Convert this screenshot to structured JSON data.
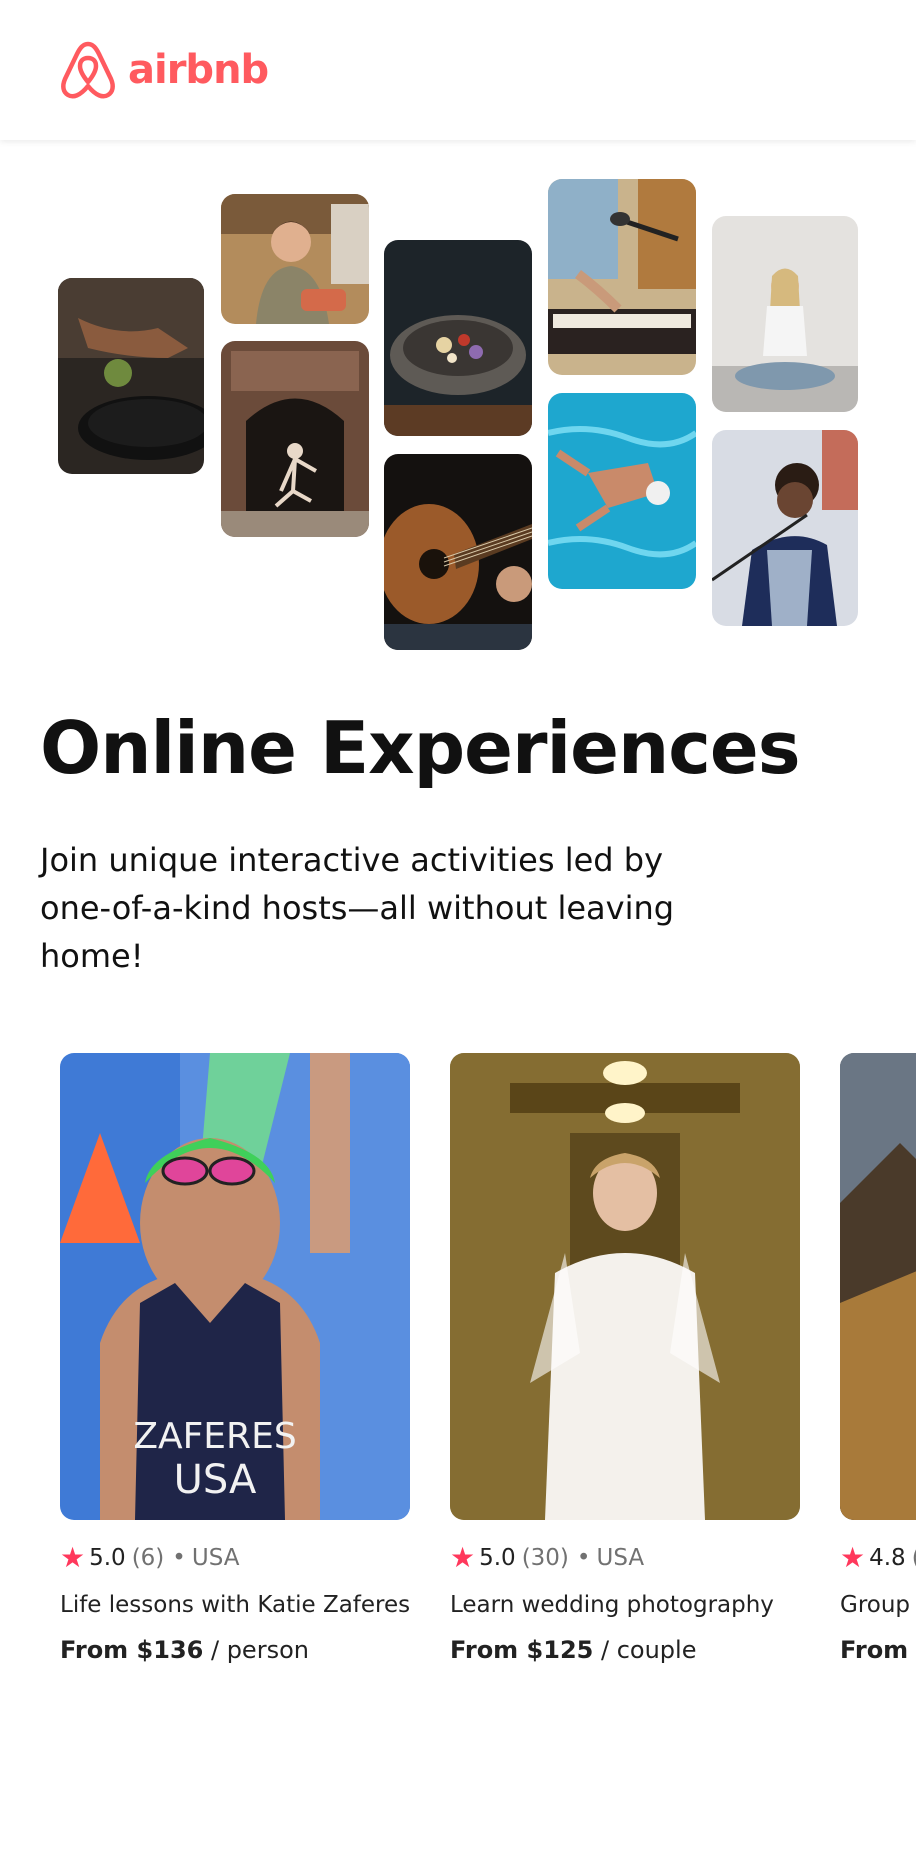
{
  "brand": {
    "name": "airbnb",
    "color": "#FF5A5F"
  },
  "hero": {
    "title": "Online Experiences",
    "subtitle": "Join unique interactive activities led by one-of-a-kind hosts—all without leaving home!"
  },
  "collage": [
    {
      "name": "cooking-pan-photo"
    },
    {
      "name": "chef-woman-photo"
    },
    {
      "name": "dancer-archway-photo"
    },
    {
      "name": "food-bowl-photo"
    },
    {
      "name": "guitar-photo"
    },
    {
      "name": "piano-microphone-photo"
    },
    {
      "name": "swimmer-photo"
    },
    {
      "name": "yoga-photo"
    },
    {
      "name": "singer-photo"
    }
  ],
  "cards": [
    {
      "rating": "5.0",
      "reviews": "(6)",
      "separator": "•",
      "country": "USA",
      "title": "Life lessons with Katie Zaferes",
      "price": "From $136",
      "unit": "/ person",
      "jersey_line1": "ZAFERES",
      "jersey_line2": "USA"
    },
    {
      "rating": "5.0",
      "reviews": "(30)",
      "separator": "•",
      "country": "USA",
      "title": "Learn wedding photography",
      "price": "From $125",
      "unit": "/ couple"
    },
    {
      "rating": "4.8",
      "reviews": "(",
      "separator": "",
      "country": "",
      "title": "Group",
      "price": "From $",
      "unit": ""
    }
  ],
  "colors": {
    "star": "#FF385C",
    "muted": "#717171",
    "text": "#222222"
  },
  "icons": {
    "logo": "airbnb-belo-icon",
    "star": "star-icon"
  }
}
